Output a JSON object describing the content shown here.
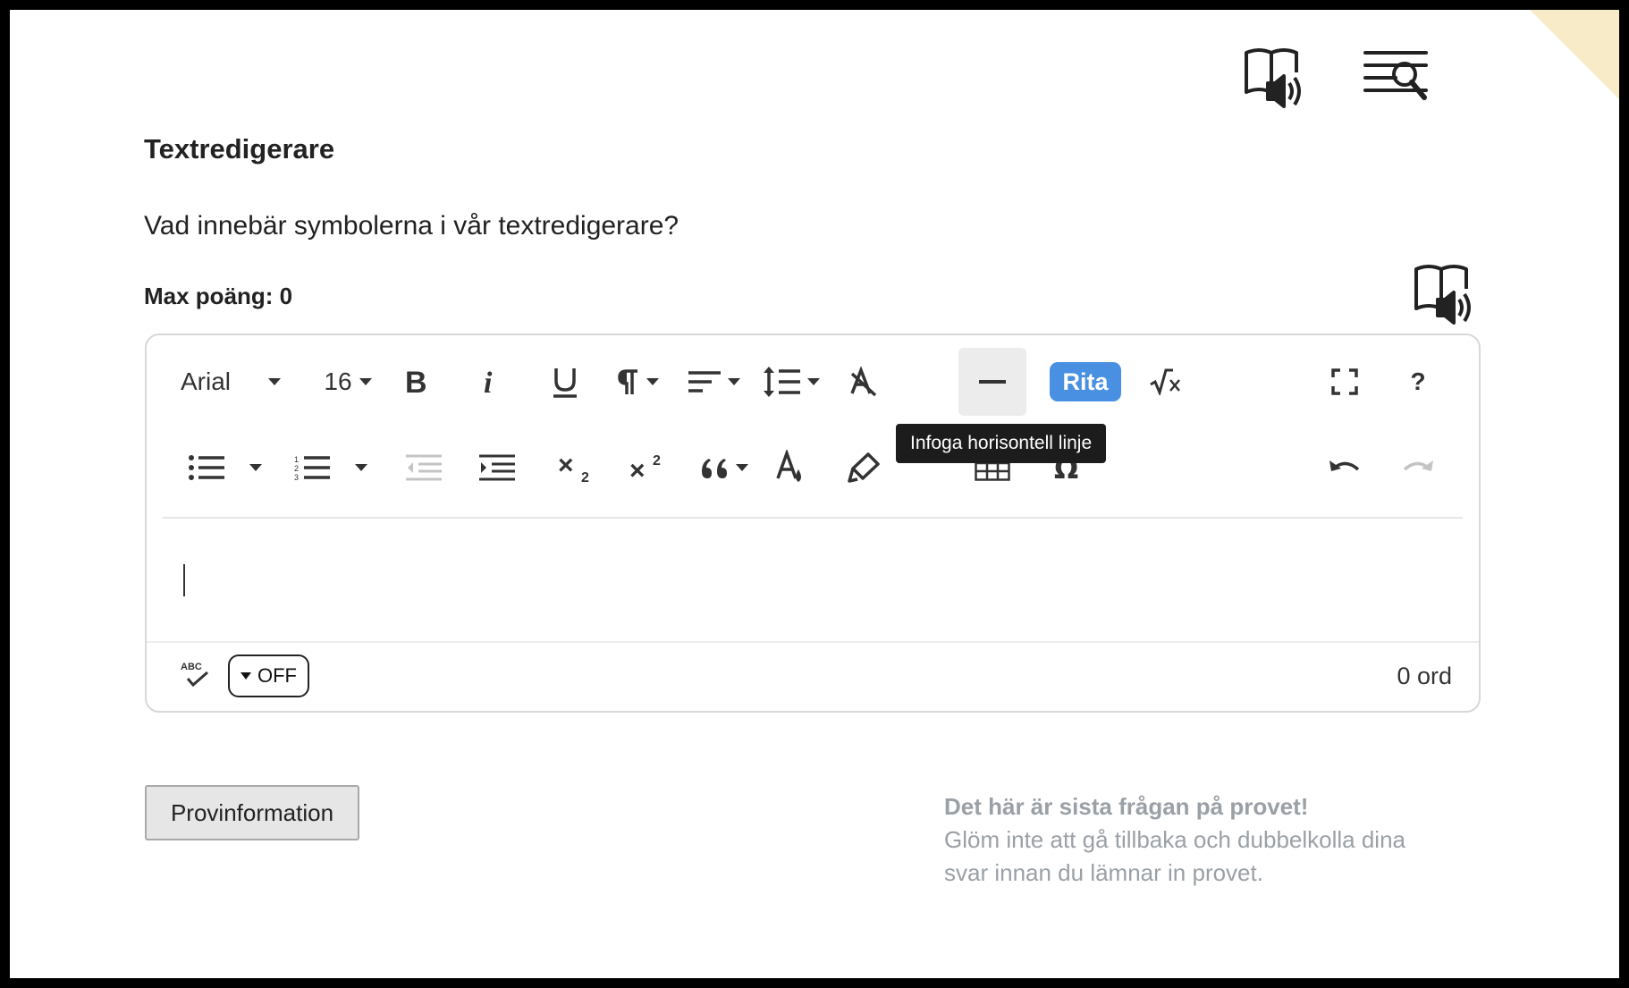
{
  "header": {
    "read_aloud_icon": "book-speaker-icon",
    "search_icon": "text-search-icon"
  },
  "question": {
    "title": "Textredigerare",
    "text": "Vad innebär symbolerna i vår textredigerare?",
    "max_points": "Max poäng: 0",
    "audio_icon": "book-speaker-icon"
  },
  "editor": {
    "font_family": "Arial",
    "font_size": "16",
    "draw_label": "Rita",
    "help_label": "?",
    "tooltip": "Infoga horisontell linje",
    "content": "",
    "spellcheck_state": "OFF",
    "word_count": "0 ord"
  },
  "footer": {
    "info_button": "Provinformation",
    "final_title": "Det här är sista frågan på provet!",
    "final_text": "Glöm inte att gå tillbaka och dubbelkolla dina svar innan du lämnar in provet."
  },
  "colors": {
    "accent": "#4a90e2",
    "corner": "#f8ecc8",
    "note": "#9aa0a6"
  }
}
